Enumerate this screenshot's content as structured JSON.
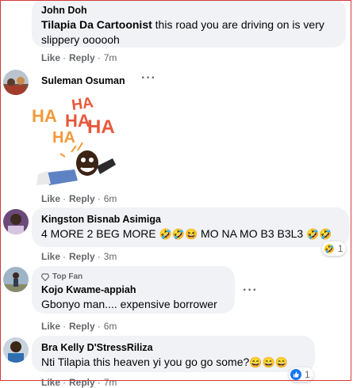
{
  "comments": [
    {
      "author": "John Doh",
      "mention": "Tilapia Da Cartoonist",
      "text_line1": " this road you are driving on is very",
      "text_line2": "slippery oooooh",
      "like": "Like",
      "reply": "Reply",
      "time": "7m"
    },
    {
      "author": "Suleman Osuman",
      "sticker_words": [
        "HA",
        "HA",
        "HA",
        "HA",
        "HA"
      ],
      "like": "Like",
      "reply": "Reply",
      "time": "6m"
    },
    {
      "author": "Kingston Bisnab Asimiga",
      "text_a": "4 MORE 2 BEG MORE ",
      "text_b": " MO NA MO B3 B3L3 ",
      "like": "Like",
      "reply": "Reply",
      "time": "3m",
      "reaction_count": "1"
    },
    {
      "badge": "Top Fan",
      "author": "Kojo Kwame-appiah",
      "text": "Gbonyo man.... expensive borrower",
      "like": "Like",
      "reply": "Reply",
      "time": "6m"
    },
    {
      "author": "Bra Kelly D'StressRiliza",
      "text": "Nti Tilapia this heaven yi you go go some?",
      "like": "Like",
      "reply": "Reply",
      "time": "7m",
      "reaction_count": "1"
    }
  ],
  "icons": {
    "laugh": "rolling-on-floor-laughing-emoji",
    "grin": "grinning-squinting-emoji",
    "like": "thumbs-up-icon",
    "more": "more-options-icon",
    "topfan": "diamond-icon"
  },
  "colors": {
    "bubble": "#f0f2f5",
    "meta": "#65676b",
    "like_blue": "#1877f2"
  }
}
